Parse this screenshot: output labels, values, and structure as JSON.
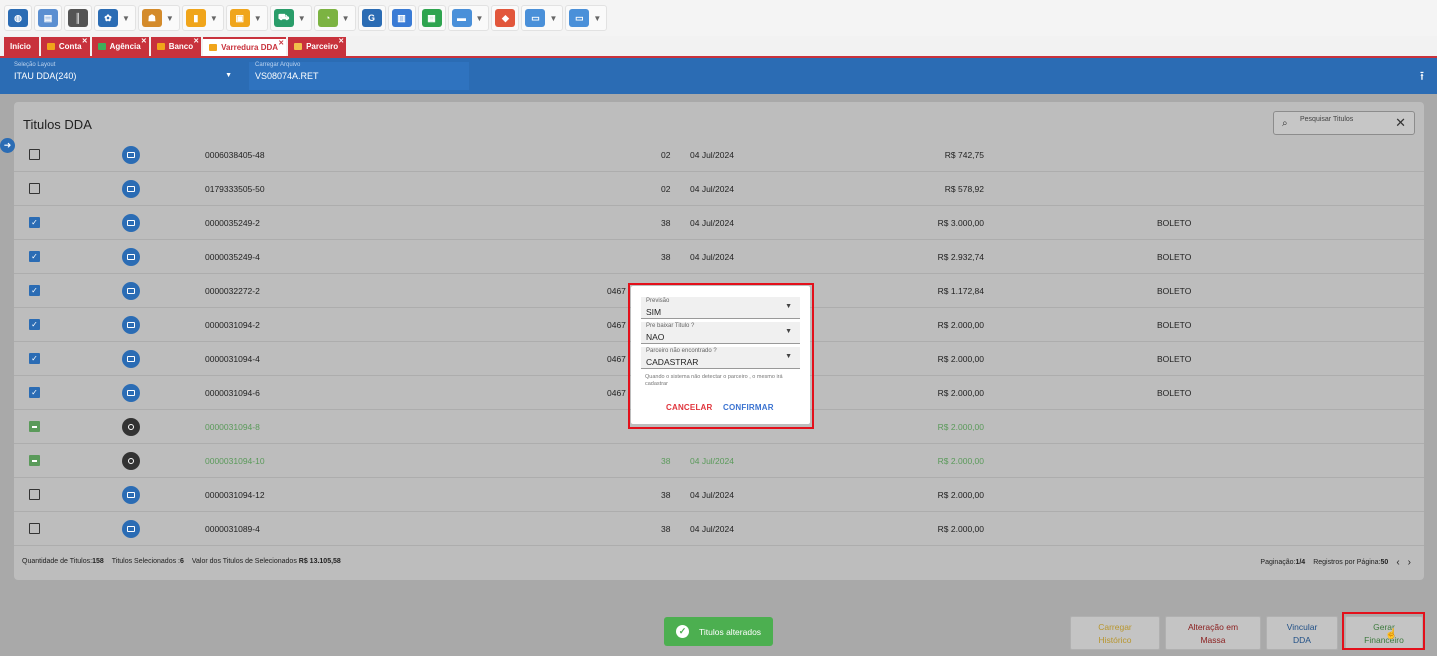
{
  "toolbar": {
    "icons": [
      {
        "name": "globe-icon",
        "color": "#2b6cb4",
        "glyph": "◍",
        "caret": false
      },
      {
        "name": "store-icon",
        "color": "#5b8fd1",
        "glyph": "▤",
        "caret": false
      },
      {
        "name": "barcode-icon",
        "color": "#555555",
        "glyph": "║",
        "caret": false
      },
      {
        "name": "settings-icon",
        "color": "#2b6cb4",
        "glyph": "✿",
        "caret": true
      },
      {
        "name": "users-icon",
        "color": "#d48b2b",
        "glyph": "☗",
        "caret": true
      },
      {
        "name": "chart-icon",
        "color": "#f0a51b",
        "glyph": "▮",
        "caret": true
      },
      {
        "name": "box-icon",
        "color": "#f0a51b",
        "glyph": "▣",
        "caret": true
      },
      {
        "name": "cart-icon",
        "color": "#2a9d6a",
        "glyph": "⛟",
        "caret": true
      },
      {
        "name": "pie-icon",
        "color": "#7cb342",
        "glyph": "◔",
        "caret": true
      },
      {
        "name": "refresh-icon",
        "color": "#2b6cb4",
        "glyph": "G",
        "caret": false
      },
      {
        "name": "documents-icon",
        "color": "#3a7bd5",
        "glyph": "▥",
        "caret": false
      },
      {
        "name": "save-icon",
        "color": "#2ea44f",
        "glyph": "▦",
        "caret": false
      },
      {
        "name": "folder-icon",
        "color": "#4a90d9",
        "glyph": "▬",
        "caret": true
      },
      {
        "name": "tag-icon",
        "color": "#e2573c",
        "glyph": "◆",
        "caret": false
      },
      {
        "name": "monitor-icon",
        "color": "#4a90d9",
        "glyph": "▭",
        "caret": true
      },
      {
        "name": "window-icon",
        "color": "#4a90d9",
        "glyph": "▭",
        "caret": true
      }
    ]
  },
  "tabs": [
    {
      "label": "Início",
      "icon_color": "",
      "active": false,
      "closable": false
    },
    {
      "label": "Conta",
      "icon_color": "#f0a51b",
      "active": false,
      "closable": true
    },
    {
      "label": "Agência",
      "icon_color": "#3fae5a",
      "active": false,
      "closable": true
    },
    {
      "label": "Banco",
      "icon_color": "#f0a51b",
      "active": false,
      "closable": true
    },
    {
      "label": "Varredura DDA",
      "icon_color": "#f0a51b",
      "active": true,
      "closable": true
    },
    {
      "label": "Parceiro",
      "icon_color": "#f0c04b",
      "active": false,
      "closable": true
    }
  ],
  "header": {
    "layout_label": "Seleção Layout",
    "layout_value": "ITAU DDA(240)",
    "file_label": "Carregar Arquivo",
    "file_value": "VS08074A.RET"
  },
  "panel": {
    "title": "Titulos DDA",
    "search_placeholder": "Pesquisar Titulos"
  },
  "rows": [
    {
      "state": "off",
      "icon": "blue",
      "number": "0006038405-48",
      "code": "",
      "qty": "02",
      "date": "04 Jul/2024",
      "value": "R$ 742,75",
      "type": ""
    },
    {
      "state": "off",
      "icon": "blue",
      "number": "0179333505-50",
      "code": "",
      "qty": "02",
      "date": "04 Jul/2024",
      "value": "R$ 578,92",
      "type": ""
    },
    {
      "state": "on",
      "icon": "blue",
      "number": "0000035249-2",
      "code": "",
      "qty": "38",
      "date": "04 Jul/2024",
      "value": "R$ 3.000,00",
      "type": "BOLETO"
    },
    {
      "state": "on",
      "icon": "blue",
      "number": "0000035249-4",
      "code": "",
      "qty": "38",
      "date": "04 Jul/2024",
      "value": "R$ 2.932,74",
      "type": "BOLETO"
    },
    {
      "state": "on",
      "icon": "blue",
      "number": "0000032272-2",
      "code": "0467",
      "qty": "",
      "date": "",
      "value": "R$ 1.172,84",
      "type": "BOLETO"
    },
    {
      "state": "on",
      "icon": "blue",
      "number": "0000031094-2",
      "code": "0467",
      "qty": "",
      "date": "",
      "value": "R$ 2.000,00",
      "type": "BOLETO"
    },
    {
      "state": "on",
      "icon": "blue",
      "number": "0000031094-4",
      "code": "0467",
      "qty": "",
      "date": "",
      "value": "R$ 2.000,00",
      "type": "BOLETO"
    },
    {
      "state": "on",
      "icon": "blue",
      "number": "0000031094-6",
      "code": "0467",
      "qty": "",
      "date": "",
      "value": "R$ 2.000,00",
      "type": "BOLETO"
    },
    {
      "state": "mid",
      "icon": "dark",
      "number": "0000031094-8",
      "code": "",
      "qty": "",
      "date": "",
      "value": "R$ 2.000,00",
      "type": ""
    },
    {
      "state": "mid",
      "icon": "dark",
      "number": "0000031094-10",
      "code": "",
      "qty": "38",
      "date": "04 Jul/2024",
      "value": "R$ 2.000,00",
      "type": ""
    },
    {
      "state": "off",
      "icon": "blue",
      "number": "0000031094-12",
      "code": "",
      "qty": "38",
      "date": "04 Jul/2024",
      "value": "R$ 2.000,00",
      "type": ""
    },
    {
      "state": "off",
      "icon": "blue",
      "number": "0000031089-4",
      "code": "",
      "qty": "38",
      "date": "04 Jul/2024",
      "value": "R$ 2.000,00",
      "type": ""
    }
  ],
  "footer": {
    "qty_label": "Quantidade de Titulos:",
    "qty_value": "158",
    "selected_label": "Titulos Selecionados :",
    "selected_value": "6",
    "sum_label": "Valor dos Titulos de Selecionados",
    "sum_value": "R$ 13.105,58",
    "page_label": "Paginação:",
    "page_value": "1/4",
    "per_page_label": "Registros por Página:",
    "per_page_value": "50",
    "prev": "‹",
    "next": "›"
  },
  "modal": {
    "field1_label": "Previsão",
    "field1_value": "SIM",
    "field2_label": "Pre baixar Titulo ?",
    "field2_value": "NAO",
    "field3_label": "Parceiro não encontrado ?",
    "field3_value": "CADASTRAR",
    "hint": "Quando o sistema não detectar o parceiro , o mesmo irá cadastrar",
    "cancel": "CANCELAR",
    "confirm": "CONFIRMAR"
  },
  "toast": {
    "text": "Titulos alterados"
  },
  "actions": {
    "load_history_1": "Carregar",
    "load_history_2": "Histórico",
    "bulk_edit_1": "Alteração em",
    "bulk_edit_2": "Massa",
    "link_dda_1": "Vincular",
    "link_dda_2": "DDA",
    "generate_1": "Gerar",
    "generate_2": "Financeiro"
  },
  "colors": {
    "brand_blue": "#2b6cb4",
    "tab_red": "#c8323c",
    "highlight_red": "#e3101b",
    "success_green": "#4caf50",
    "cancel_red": "#e0343c",
    "confirm_blue": "#3b73d1"
  }
}
